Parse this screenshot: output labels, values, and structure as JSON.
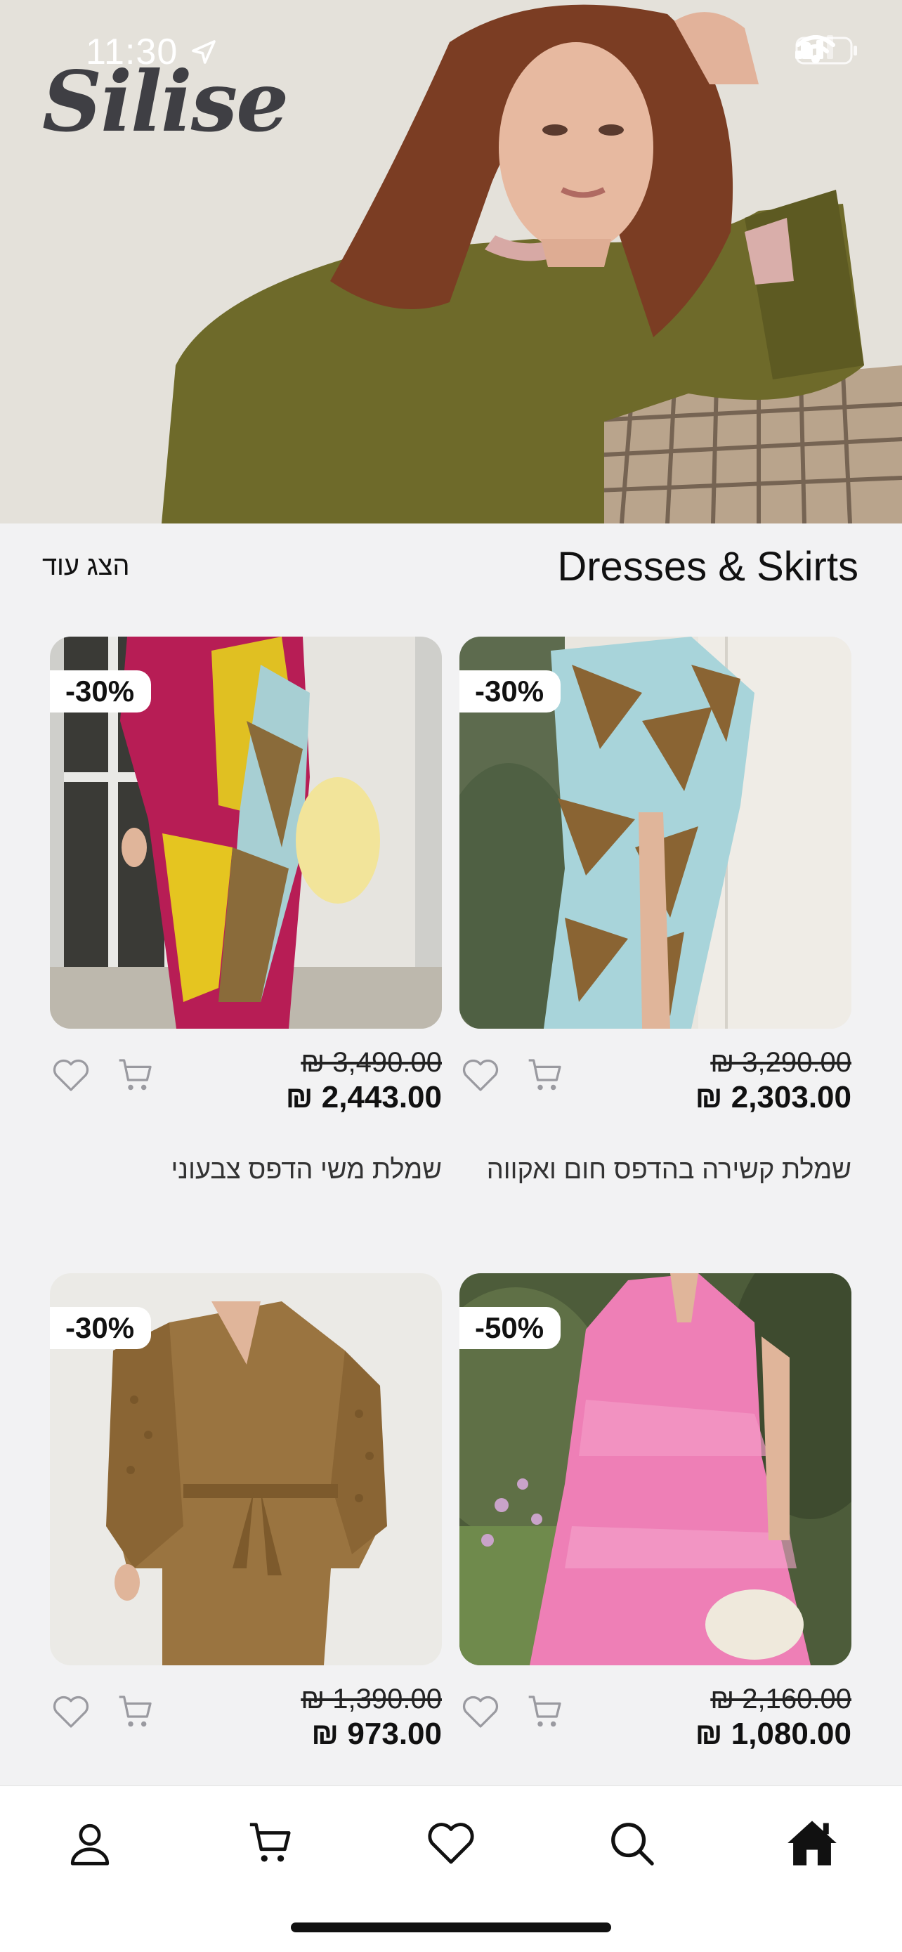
{
  "status_bar": {
    "time": "11:30"
  },
  "brand": {
    "logo_text": "Silise"
  },
  "section": {
    "title": "Dresses & Skirts",
    "show_more": "הצג עוד"
  },
  "products": [
    {
      "discount": "-30%",
      "old_price": "₪ 3,490.00",
      "new_price": "₪ 2,443.00",
      "name": "שמלת משי הדפס צבעוני"
    },
    {
      "discount": "-30%",
      "old_price": "₪ 3,290.00",
      "new_price": "₪ 2,303.00",
      "name": "שמלת קשירה בהדפס חום ואקווה"
    },
    {
      "discount": "-30%",
      "old_price": "₪ 1,390.00",
      "new_price": "₪ 973.00",
      "name": ""
    },
    {
      "discount": "-50%",
      "old_price": "₪ 2,160.00",
      "new_price": "₪ 1,080.00",
      "name": ""
    }
  ],
  "tabbar": {
    "items": [
      {
        "icon": "profile-icon"
      },
      {
        "icon": "cart-icon"
      },
      {
        "icon": "heart-icon"
      },
      {
        "icon": "search-icon"
      },
      {
        "icon": "home-icon",
        "active": true
      }
    ]
  }
}
